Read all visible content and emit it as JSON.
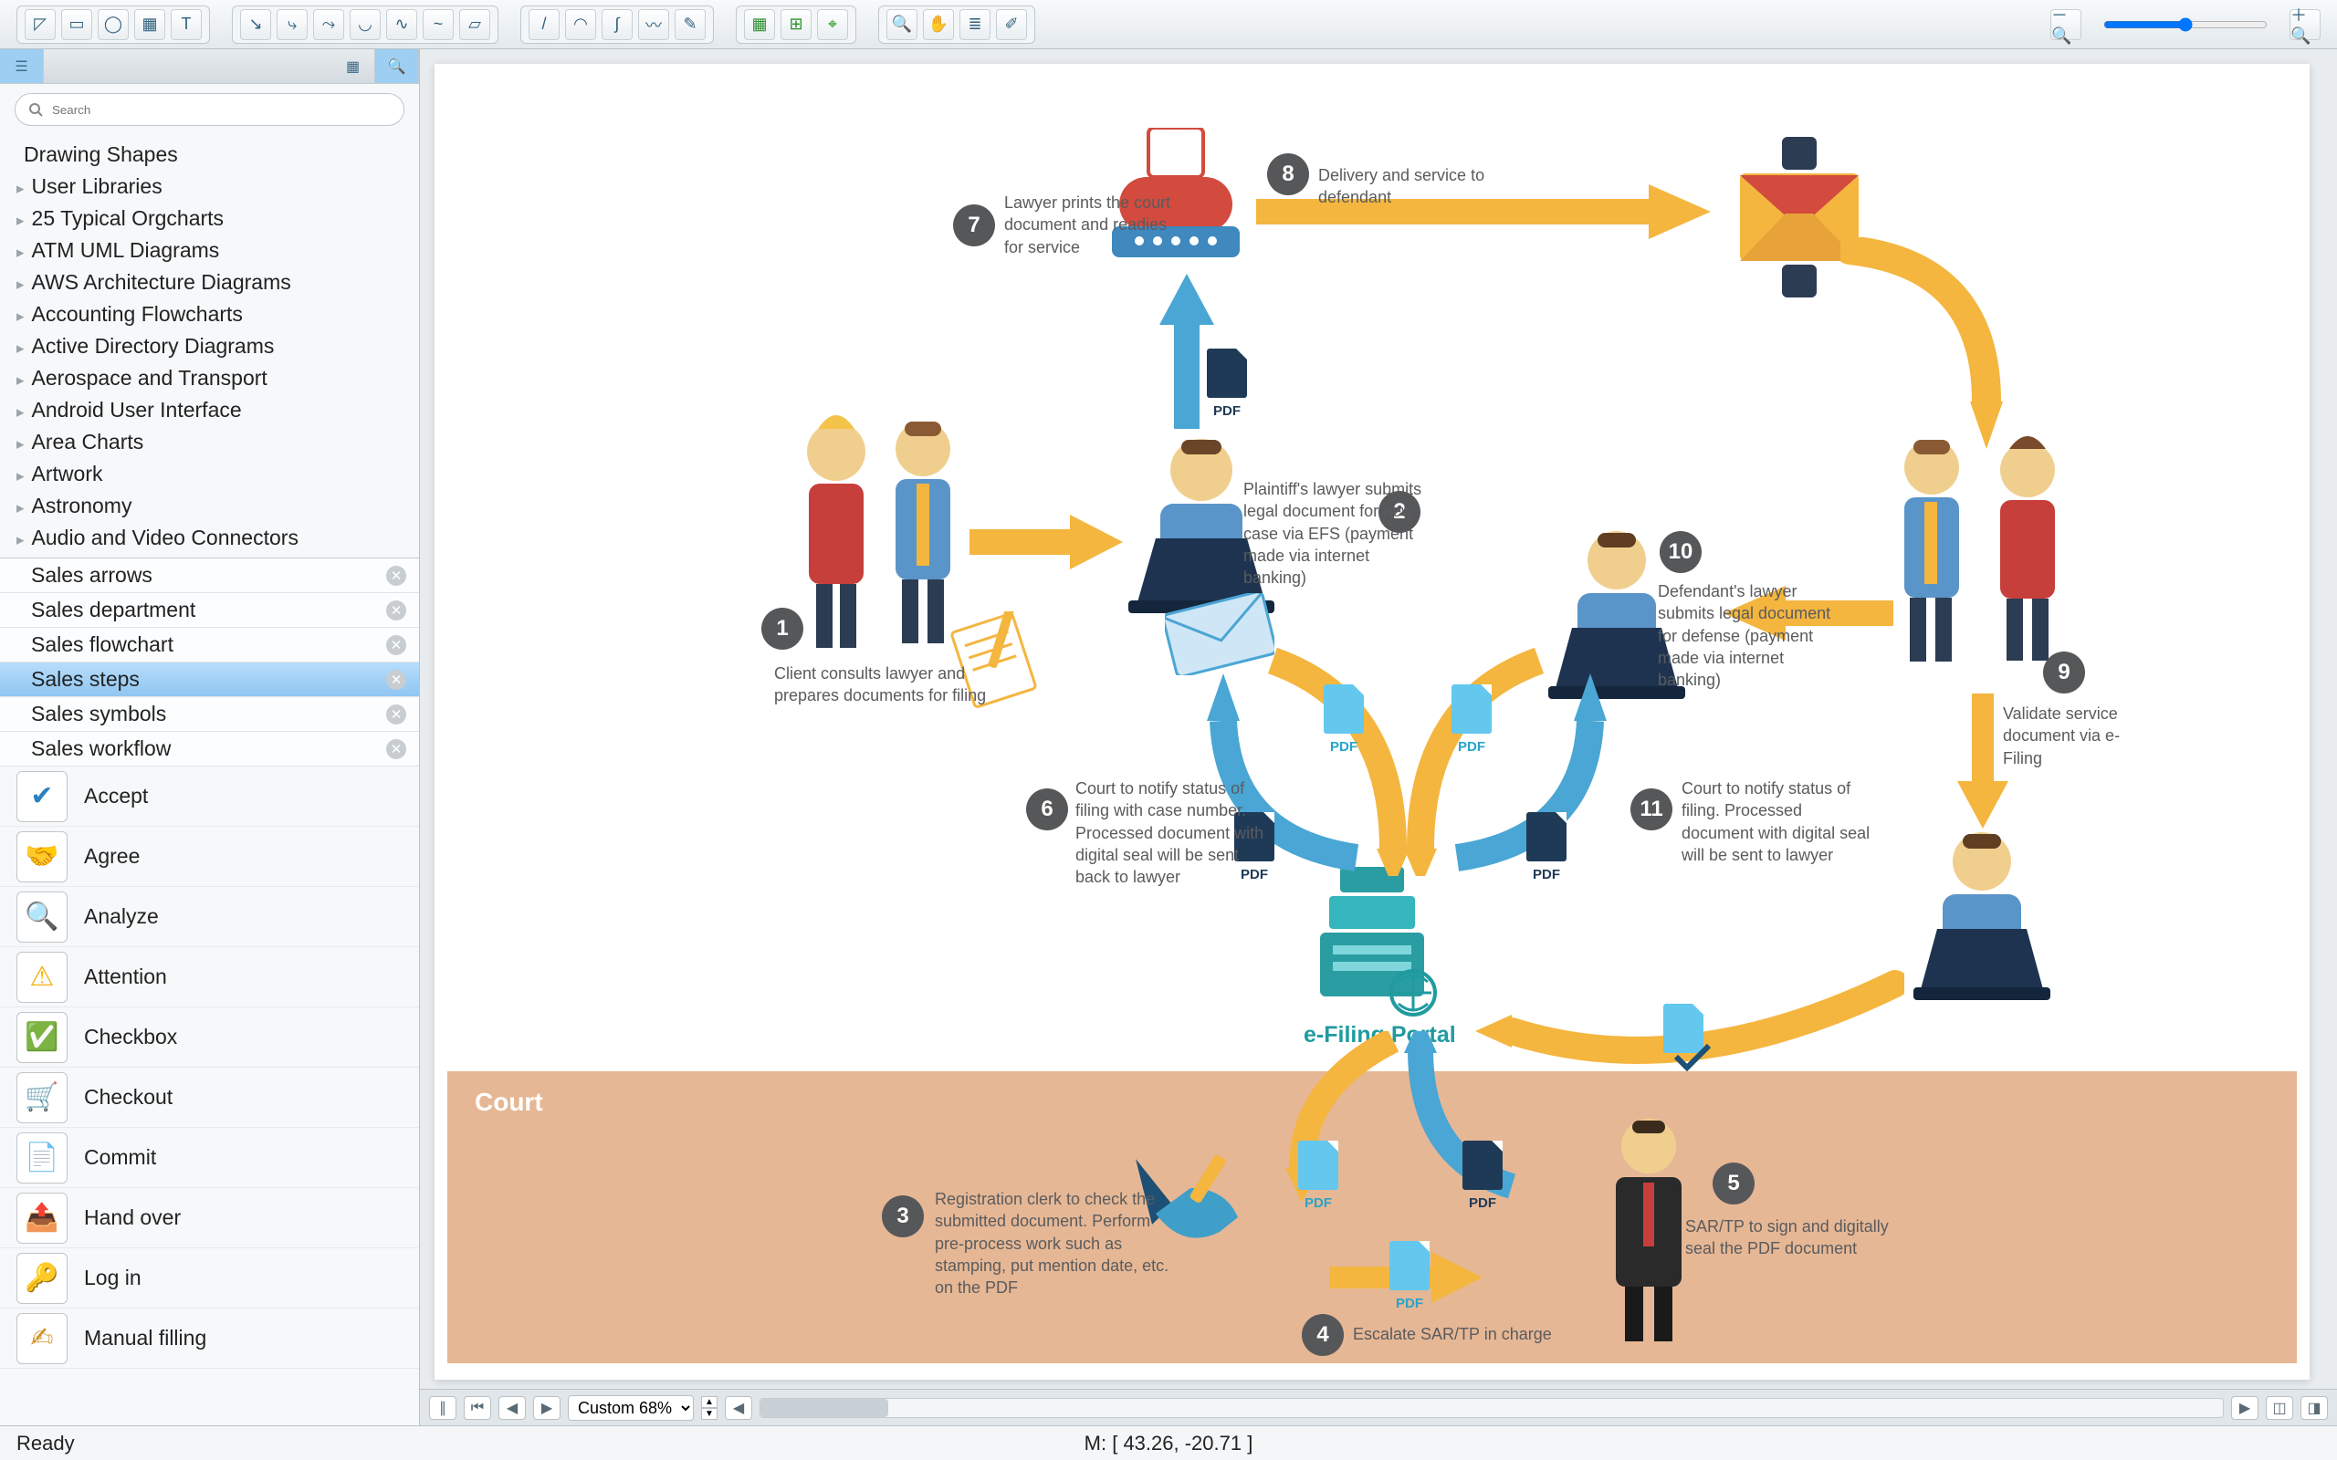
{
  "toolbar": {
    "zoom_value": 50,
    "groups": [
      [
        "select",
        "rect",
        "ellipse",
        "table",
        "text"
      ],
      [
        "conn-direct",
        "conn-smart",
        "conn-round",
        "conn-arc",
        "conn-curve",
        "conn-spline",
        "page"
      ],
      [
        "line",
        "arc2",
        "spline2",
        "bezier",
        "scribble"
      ],
      [
        "snap-grid",
        "snap-guides",
        "snap-obj"
      ],
      [
        "zoom-tool",
        "pan",
        "layers",
        "eyedrop"
      ]
    ]
  },
  "sidebar": {
    "search_placeholder": "Search",
    "tree_header": "Drawing Shapes",
    "tree": [
      "User Libraries",
      "25 Typical Orgcharts",
      "ATM UML Diagrams",
      "AWS Architecture Diagrams",
      "Accounting Flowcharts",
      "Active Directory Diagrams",
      "Aerospace and Transport",
      "Android User Interface",
      "Area Charts",
      "Artwork",
      "Astronomy",
      "Audio and Video Connectors"
    ],
    "sets": [
      {
        "label": "Sales arrows"
      },
      {
        "label": "Sales department"
      },
      {
        "label": "Sales flowchart"
      },
      {
        "label": "Sales steps",
        "active": true
      },
      {
        "label": "Sales symbols"
      },
      {
        "label": "Sales workflow"
      }
    ],
    "shapes": [
      {
        "label": "Accept",
        "glyph": "✔︎",
        "tint": "#2c7fbf"
      },
      {
        "label": "Agree",
        "glyph": "🤝",
        "tint": "#d0902a"
      },
      {
        "label": "Analyze",
        "glyph": "🔍",
        "tint": "#d24b3e"
      },
      {
        "label": "Attention",
        "glyph": "⚠︎",
        "tint": "#f2b20f"
      },
      {
        "label": "Checkbox",
        "glyph": "✅",
        "tint": "#5aa02c"
      },
      {
        "label": "Checkout",
        "glyph": "🛒",
        "tint": "#d24b3e"
      },
      {
        "label": "Commit",
        "glyph": "📄",
        "tint": "#2c7fbf"
      },
      {
        "label": "Hand over",
        "glyph": "📤",
        "tint": "#d24b3e"
      },
      {
        "label": "Log in",
        "glyph": "🔑",
        "tint": "#2c7fbf"
      },
      {
        "label": "Manual filling",
        "glyph": "✍︎",
        "tint": "#d0902a"
      }
    ]
  },
  "canvas": {
    "zoom_label": "Custom 68%",
    "court_title": "Court",
    "portal_label": "e-Filing Portal",
    "steps": {
      "1": "Client consults lawyer and prepares documents for filing",
      "2": "Plaintiff's lawyer submits legal document for new case via EFS (payment made via internet banking)",
      "3": "Registration clerk to check the submitted document. Perform pre-process work such as stamping, put mention date, etc. on the PDF",
      "4": "Escalate SAR/TP in charge",
      "5": "SAR/TP to sign and digitally seal the PDF document",
      "6": "Court to notify status of filing with case number. Processed document with digital seal will be sent back to lawyer",
      "7": "Lawyer prints the court document and readies for service",
      "8": "Delivery and service to defendant",
      "9": "Validate service document via e-Filing",
      "10": "Defendant's lawyer submits legal document for defense (payment made via internet banking)",
      "11": "Court to notify status of filing. Processed document with digital seal will be sent to lawyer"
    },
    "pdf_label": "PDF"
  },
  "status": {
    "left": "Ready",
    "center": "M: [ 43.26, -20.71 ]"
  },
  "colors": {
    "arrow_yellow": "#f4b63f",
    "arrow_blue": "#4aa6d4",
    "num_bg": "#565759"
  }
}
